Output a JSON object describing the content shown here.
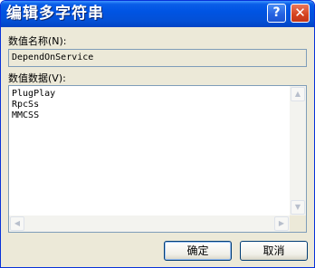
{
  "window": {
    "title": "编辑多字符串",
    "help_glyph": "?",
    "close_glyph": "✕"
  },
  "name_label": "数值名称(N):",
  "name_value": "DependOnService",
  "data_label": "数值数据(V):",
  "data_value": "PlugPlay\nRpcSs\nMMCSS",
  "scrollbar": {
    "up_glyph": "▲",
    "down_glyph": "▼",
    "left_glyph": "◀",
    "right_glyph": "▶"
  },
  "buttons": {
    "ok": "确定",
    "cancel": "取消"
  },
  "colors": {
    "titlebar": "#0054e3",
    "window_bg": "#ece9d8",
    "close": "#d5431e"
  },
  "icons": [
    "help-icon",
    "close-icon"
  ]
}
